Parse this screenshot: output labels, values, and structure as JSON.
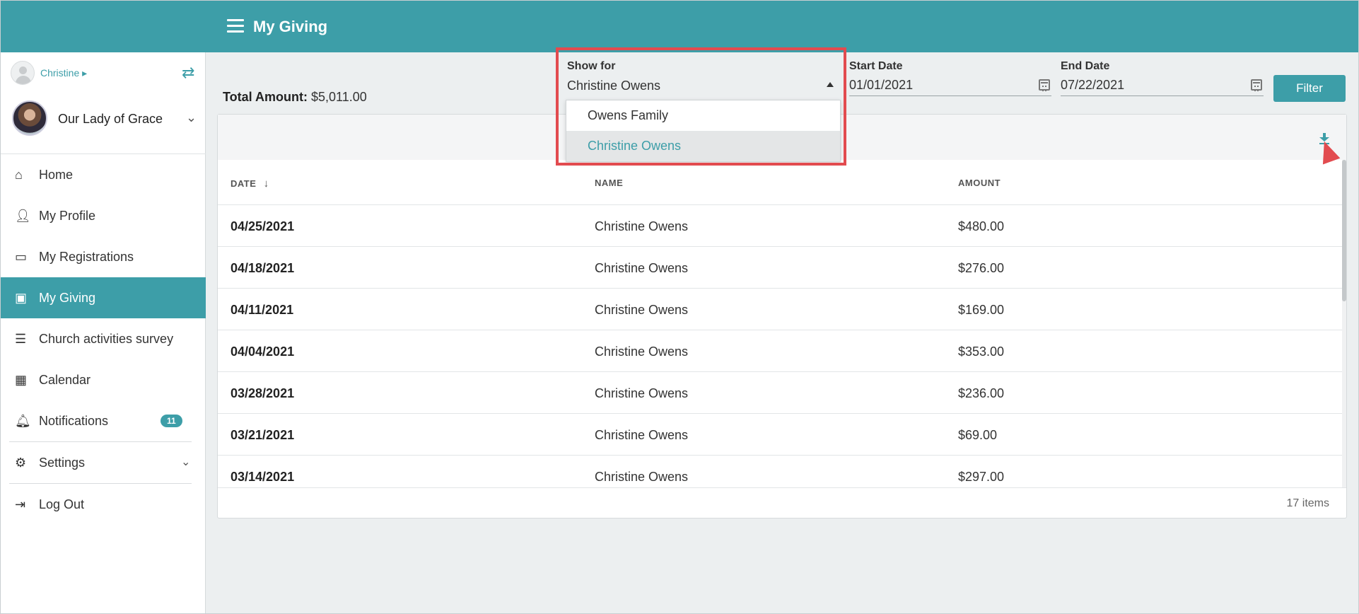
{
  "header": {
    "title": "My Giving"
  },
  "user": {
    "name": "Christine ▸"
  },
  "parish": {
    "name": "Our Lady of Grace"
  },
  "sidebar": {
    "items": [
      {
        "label": "Home"
      },
      {
        "label": "My Profile"
      },
      {
        "label": "My Registrations"
      },
      {
        "label": "My Giving"
      },
      {
        "label": "Church activities survey"
      },
      {
        "label": "Calendar"
      },
      {
        "label": "Notifications",
        "badge": "11"
      },
      {
        "label": "Settings"
      },
      {
        "label": "Log Out"
      }
    ]
  },
  "summary": {
    "total_label": "Total Amount:",
    "total_value": "$5,011.00"
  },
  "filters": {
    "show_for_label": "Show for",
    "show_for_value": "Christine Owens",
    "options": [
      "Owens Family",
      "Christine Owens"
    ],
    "start_label": "Start Date",
    "start_value": "01/01/2021",
    "end_label": "End Date",
    "end_value": "07/22/2021",
    "filter_button": "Filter"
  },
  "table": {
    "columns": [
      "DATE",
      "NAME",
      "AMOUNT"
    ],
    "sort_indicator": "↓",
    "rows": [
      {
        "date": "04/25/2021",
        "name": "Christine Owens",
        "amount": "$480.00"
      },
      {
        "date": "04/18/2021",
        "name": "Christine Owens",
        "amount": "$276.00"
      },
      {
        "date": "04/11/2021",
        "name": "Christine Owens",
        "amount": "$169.00"
      },
      {
        "date": "04/04/2021",
        "name": "Christine Owens",
        "amount": "$353.00"
      },
      {
        "date": "03/28/2021",
        "name": "Christine Owens",
        "amount": "$236.00"
      },
      {
        "date": "03/21/2021",
        "name": "Christine Owens",
        "amount": "$69.00"
      },
      {
        "date": "03/14/2021",
        "name": "Christine Owens",
        "amount": "$297.00"
      }
    ],
    "items_count": "17 items"
  },
  "colors": {
    "accent": "#3d9ea8",
    "highlight": "#e24b4f"
  },
  "icons": [
    "menu-icon",
    "swap-icon",
    "home-icon",
    "user-icon",
    "ticket-icon",
    "money-icon",
    "list-icon",
    "calendar-icon",
    "bell-icon",
    "gear-icon",
    "logout-icon",
    "download-icon"
  ]
}
